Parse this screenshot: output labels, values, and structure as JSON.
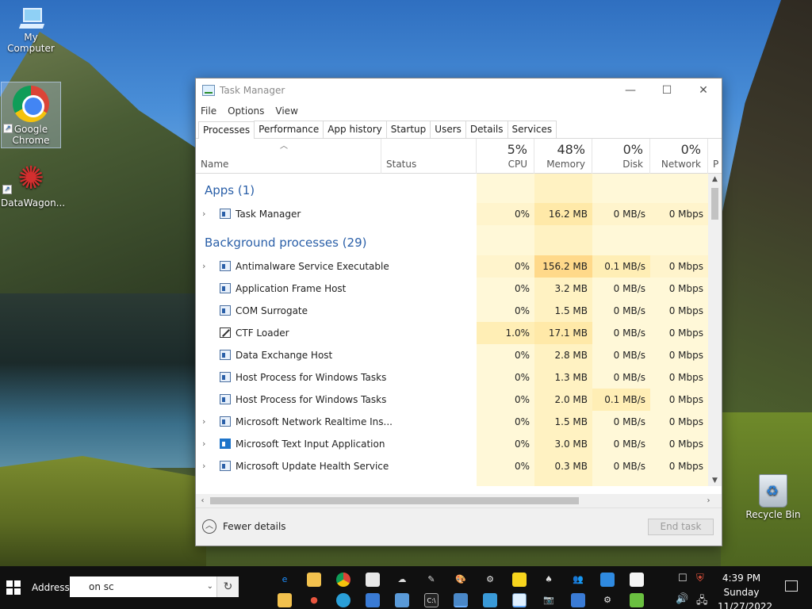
{
  "desktop": {
    "icons": [
      {
        "label": "My Computer"
      },
      {
        "label": "Google Chrome"
      },
      {
        "label": "DataWagon..."
      },
      {
        "label": "Recycle Bin"
      }
    ]
  },
  "window": {
    "title": "Task Manager",
    "menu": [
      "File",
      "Options",
      "View"
    ],
    "tabs": [
      "Processes",
      "Performance",
      "App history",
      "Startup",
      "Users",
      "Details",
      "Services"
    ],
    "active_tab": "Processes",
    "columns": {
      "name": "Name",
      "status": "Status",
      "cpu": {
        "pct": "5%",
        "label": "CPU"
      },
      "memory": {
        "pct": "48%",
        "label": "Memory"
      },
      "disk": {
        "pct": "0%",
        "label": "Disk"
      },
      "network": {
        "pct": "0%",
        "label": "Network"
      },
      "power": "P"
    },
    "groups": [
      {
        "title": "Apps (1)"
      },
      {
        "title": "Background processes (29)"
      }
    ],
    "apps": [
      {
        "name": "Task Manager",
        "cpu": "0%",
        "memory": "16.2 MB",
        "disk": "0 MB/s",
        "network": "0 Mbps",
        "expandable": true
      }
    ],
    "background": [
      {
        "name": "Antimalware Service Executable",
        "cpu": "0%",
        "memory": "156.2 MB",
        "disk": "0.1 MB/s",
        "network": "0 Mbps",
        "expandable": true
      },
      {
        "name": "Application Frame Host",
        "cpu": "0%",
        "memory": "3.2 MB",
        "disk": "0 MB/s",
        "network": "0 Mbps",
        "expandable": false
      },
      {
        "name": "COM Surrogate",
        "cpu": "0%",
        "memory": "1.5 MB",
        "disk": "0 MB/s",
        "network": "0 Mbps",
        "expandable": false
      },
      {
        "name": "CTF Loader",
        "cpu": "1.0%",
        "memory": "17.1 MB",
        "disk": "0 MB/s",
        "network": "0 Mbps",
        "expandable": false
      },
      {
        "name": "Data Exchange Host",
        "cpu": "0%",
        "memory": "2.8 MB",
        "disk": "0 MB/s",
        "network": "0 Mbps",
        "expandable": false
      },
      {
        "name": "Host Process for Windows Tasks",
        "cpu": "0%",
        "memory": "1.3 MB",
        "disk": "0 MB/s",
        "network": "0 Mbps",
        "expandable": false
      },
      {
        "name": "Host Process for Windows Tasks",
        "cpu": "0%",
        "memory": "2.0 MB",
        "disk": "0.1 MB/s",
        "network": "0 Mbps",
        "expandable": false
      },
      {
        "name": "Microsoft Network Realtime Ins...",
        "cpu": "0%",
        "memory": "1.5 MB",
        "disk": "0 MB/s",
        "network": "0 Mbps",
        "expandable": true
      },
      {
        "name": "Microsoft Text Input Application",
        "cpu": "0%",
        "memory": "3.0 MB",
        "disk": "0 MB/s",
        "network": "0 Mbps",
        "expandable": true
      },
      {
        "name": "Microsoft Update Health Service",
        "cpu": "0%",
        "memory": "0.3 MB",
        "disk": "0 MB/s",
        "network": "0 Mbps",
        "expandable": true
      }
    ],
    "footer": {
      "fewer_details": "Fewer details",
      "end_task": "End task"
    }
  },
  "taskbar": {
    "address_label": "Address",
    "address_value": "on sc",
    "time": "4:39 PM",
    "day": "Sunday",
    "date": "11/27/2022"
  }
}
